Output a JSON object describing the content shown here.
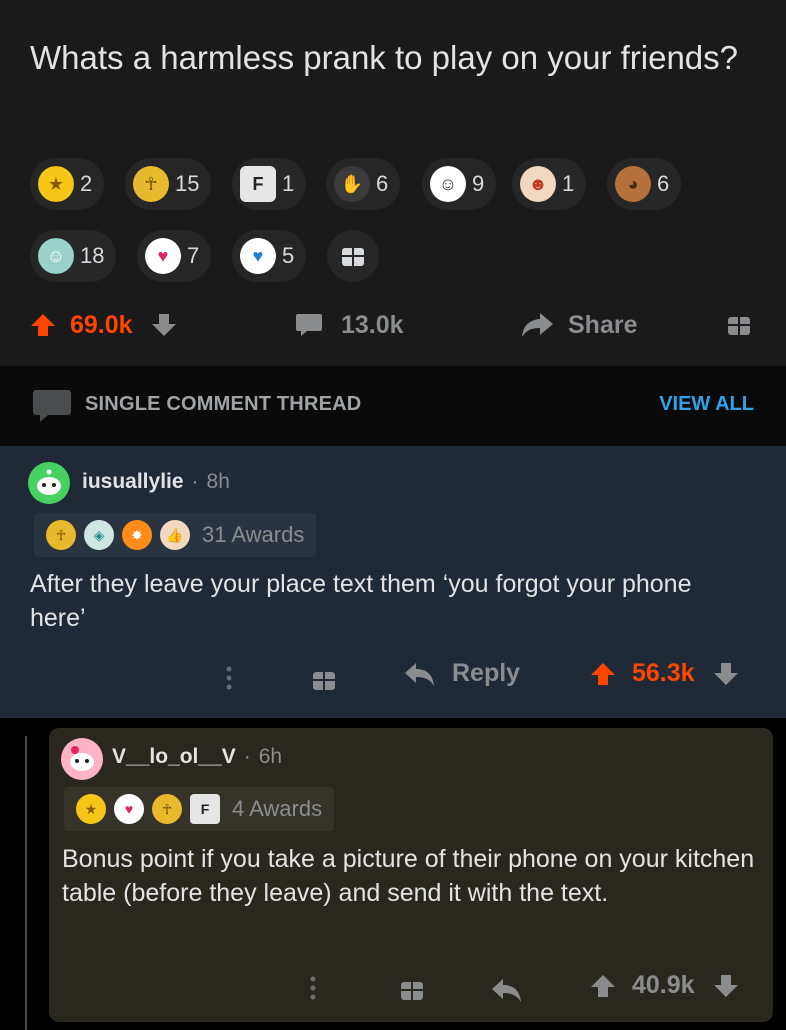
{
  "post": {
    "title": "Whats a harmless prank to play on your friends?",
    "awards_row1": [
      {
        "icon": "gold-star-award-icon",
        "count": "2",
        "color": "#f5c518"
      },
      {
        "icon": "pharaoh-award-icon",
        "count": "15",
        "color": "#e8b92d"
      },
      {
        "icon": "press-f-award-icon",
        "count": "1",
        "color": "#e6e6e6"
      },
      {
        "icon": "clapping-hands-award-icon",
        "count": "6",
        "color": "#d9d9d9"
      },
      {
        "icon": "snoo-helpful-award-icon",
        "count": "9",
        "color": "#ffffff"
      },
      {
        "icon": "laughing-face-award-icon",
        "count": "1",
        "color": "#f0d9c0"
      },
      {
        "icon": "sloth-award-icon",
        "count": "6",
        "color": "#b5703b"
      }
    ],
    "awards_row2": [
      {
        "icon": "angel-snoo-award-icon",
        "count": "18",
        "color": "#9ad1c9"
      },
      {
        "icon": "heart-snoo-award-icon",
        "count": "7",
        "color": "#ffffff"
      },
      {
        "icon": "wholesome-snoo-award-icon",
        "count": "5",
        "color": "#ffffff"
      }
    ],
    "upvotes": "69.0k",
    "comments": "13.0k",
    "share_label": "Share"
  },
  "thread": {
    "label": "SINGLE COMMENT THREAD",
    "view_all": "VIEW ALL"
  },
  "comment1": {
    "username": "iusuallylie",
    "age": "8h",
    "awards_label": "31 Awards",
    "body": "After they leave your place text them ‘you forgot your phone here’",
    "reply_label": "Reply",
    "votes": "56.3k"
  },
  "comment2": {
    "username": "V__lo_ol__V",
    "age": "6h",
    "awards_label": "4 Awards",
    "body": "Bonus point if you take a picture of their phone on your kitchen table (before they leave) and send it with the text.",
    "votes": "40.9k"
  },
  "separator": "·",
  "colors": {
    "upvote": "#ff4500",
    "link": "#30a2ea",
    "post_bg": "#1a1a1b",
    "comment1_bg": "#1f2a36",
    "comment2_bg": "#2a281e"
  }
}
